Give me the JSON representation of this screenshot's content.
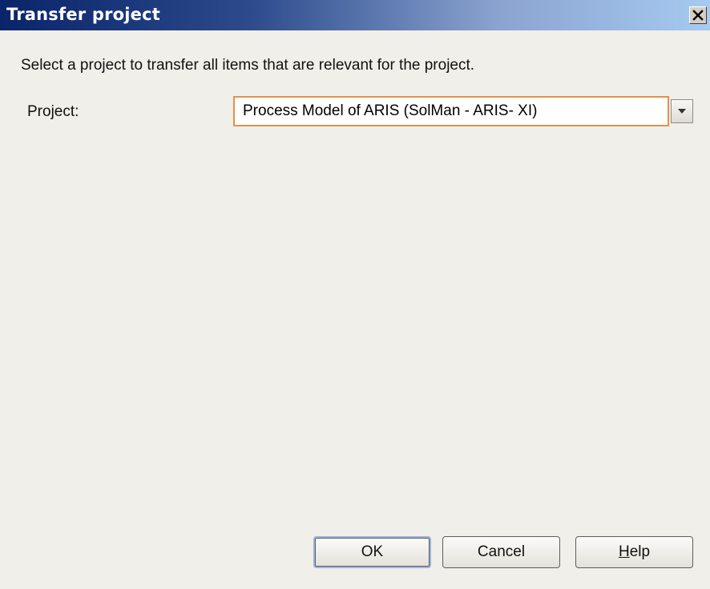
{
  "window": {
    "title": "Transfer project",
    "close_icon": "close-icon"
  },
  "instruction": "Select a project to transfer all items that are relevant for the project.",
  "project": {
    "label": "Project:",
    "selected_value": "Process Model of ARIS (SolMan - ARIS- XI)",
    "dropdown_icon": "chevron-down-icon"
  },
  "buttons": {
    "ok": "OK",
    "cancel": "Cancel",
    "help_first": "H",
    "help_rest": "elp"
  },
  "colors": {
    "titlebar_start": "#0a246a",
    "titlebar_end": "#a6caf0",
    "focus_border": "#e7904a",
    "dialog_bg": "#f0efe9"
  }
}
